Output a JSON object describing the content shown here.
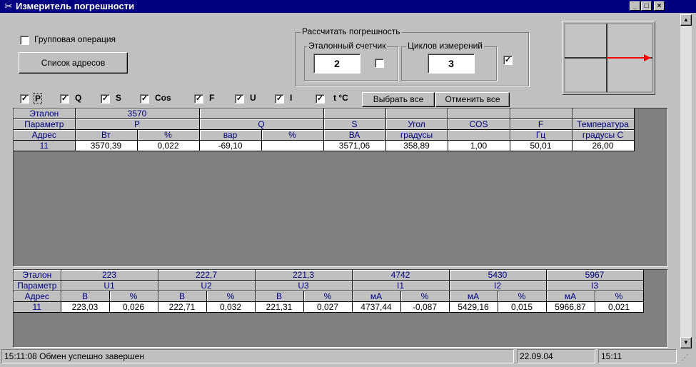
{
  "window": {
    "title": "Измеритель погрешности",
    "app_icon": "meter-icon",
    "controls": {
      "minimize": "_",
      "maximize": "□",
      "close": "×"
    }
  },
  "top_panel": {
    "group_operation": {
      "label": "Групповая операция",
      "checked": false
    },
    "address_list_button": "Список адресов",
    "calc_group": {
      "title": "Рассчитать погрешность",
      "reference_meter": {
        "title": "Эталонный счетчик",
        "value": "2",
        "checked": false
      },
      "cycles": {
        "title": "Циклов измерений",
        "value": "3",
        "checked": true
      }
    },
    "phasor": {
      "icon": "phasor-vector-icon",
      "arrow_color": "#ff0000"
    }
  },
  "param_checks": [
    {
      "label": "P",
      "checked": true
    },
    {
      "label": "Q",
      "checked": true
    },
    {
      "label": "S",
      "checked": true
    },
    {
      "label": "Cos",
      "checked": true
    },
    {
      "label": "F",
      "checked": true
    },
    {
      "label": "U",
      "checked": true
    },
    {
      "label": "I",
      "checked": true
    },
    {
      "label": "t °C",
      "checked": true
    }
  ],
  "select_all": "Выбрать все",
  "deselect_all": "Отменить все",
  "grid_power": {
    "ref_row": {
      "label": "Эталон",
      "p_value": "3570"
    },
    "param_row": {
      "label": "Параметр",
      "cols": [
        "P",
        "Q",
        "S",
        "Угол",
        "COS",
        "F",
        "Температура"
      ]
    },
    "unit_row": {
      "label": "Адрес",
      "units": [
        "Вт",
        "%",
        "вар",
        "%",
        "ВА",
        "градусы",
        "",
        "Гц",
        "градусы С"
      ]
    },
    "data_row": {
      "address": "11",
      "values": [
        "3570,39",
        "0,022",
        "-69,10",
        "",
        "3571,06",
        "358,89",
        "1,00",
        "50,01",
        "26,00"
      ]
    }
  },
  "grid_volt_current": {
    "ref_row": {
      "label": "Эталон",
      "values": [
        "223",
        "222,7",
        "221,3",
        "4742",
        "5430",
        "5967"
      ]
    },
    "param_row": {
      "label": "Параметр",
      "cols": [
        "U1",
        "U2",
        "U3",
        "I1",
        "I2",
        "I3"
      ]
    },
    "unit_row": {
      "label": "Адрес",
      "units": [
        "В",
        "%",
        "В",
        "%",
        "В",
        "%",
        "мА",
        "%",
        "мА",
        "%",
        "мА",
        "%"
      ]
    },
    "data_row": {
      "address": "11",
      "values": [
        "223,03",
        "0,026",
        "222,71",
        "0,032",
        "221,31",
        "0,027",
        "4737,44",
        "-0,087",
        "5429,16",
        "0,015",
        "5966,87",
        "0,021"
      ]
    }
  },
  "statusbar": {
    "message": "15:11:08 Обмен успешно завершен",
    "date": "22.09.04",
    "time": "15:11"
  },
  "colors": {
    "titlebar": "#000080",
    "face": "#c0c0c0",
    "header_text": "#000080",
    "grid_bg": "#808080"
  }
}
